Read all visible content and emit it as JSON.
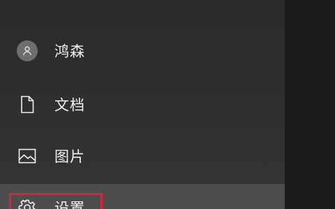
{
  "start_menu": {
    "items": [
      {
        "label": "鸿森",
        "icon": "user-avatar-icon"
      },
      {
        "label": "文档",
        "icon": "document-icon"
      },
      {
        "label": "图片",
        "icon": "picture-icon"
      },
      {
        "label": "设置",
        "icon": "gear-icon"
      }
    ]
  },
  "colors": {
    "panel_bg": "#2e2e2e",
    "selected_bg": "#4d4d4d",
    "highlight": "#d8243a",
    "text": "#f2f2f2"
  }
}
